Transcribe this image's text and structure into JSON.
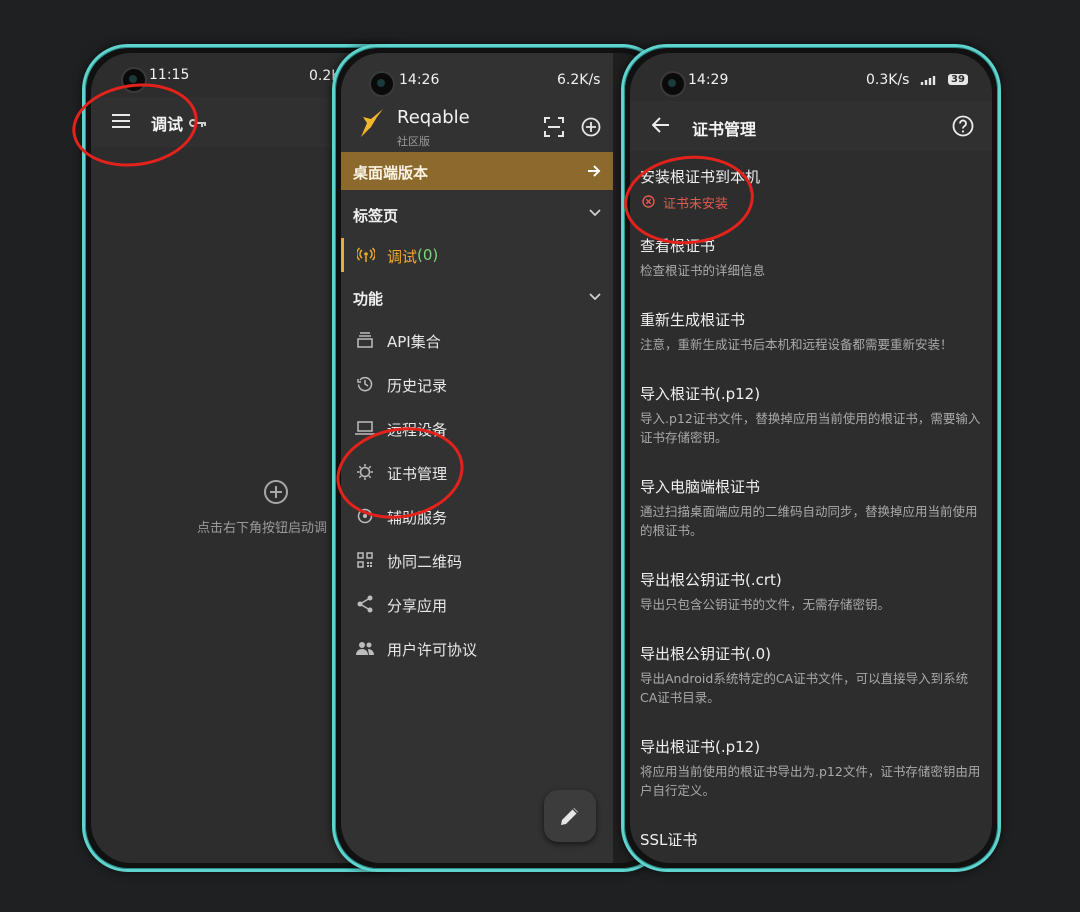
{
  "phone1": {
    "status_time": "11:15",
    "status_speed": "0.2K",
    "title": "调试",
    "empty_hint": "点击右下角按钮启动调",
    "icons": [
      "menu-icon",
      "key-icon",
      "add-circle-icon"
    ]
  },
  "phone2": {
    "status_time": "14:26",
    "status_speed": "6.2K/s",
    "app_name": "Reqable",
    "app_edition": "社区版",
    "banner": "桌面端版本",
    "section_tabs": "标签页",
    "debug_item": "调试",
    "debug_count": "(0)",
    "section_features": "功能",
    "menu": [
      {
        "label": "API集合",
        "icon": "collection-icon"
      },
      {
        "label": "历史记录",
        "icon": "history-icon"
      },
      {
        "label": "远程设备",
        "icon": "laptop-icon"
      },
      {
        "label": "证书管理",
        "icon": "gear-icon"
      },
      {
        "label": "辅助服务",
        "icon": "service-icon"
      },
      {
        "label": "协同二维码",
        "icon": "qrcode-icon"
      },
      {
        "label": "分享应用",
        "icon": "share-icon"
      },
      {
        "label": "用户许可协议",
        "icon": "people-icon"
      }
    ],
    "colors": {
      "banner": "#8c6a2e",
      "accent": "#f0a830"
    }
  },
  "phone3": {
    "status_time": "14:29",
    "status_speed": "0.3K/s",
    "battery": "39",
    "title": "证书管理",
    "install": {
      "title": "安装根证书到本机",
      "status": "证书未安装",
      "status_color": "#e05a4f"
    },
    "sections": [
      {
        "title": "查看根证书",
        "desc": "检查根证书的详细信息"
      },
      {
        "title": "重新生成根证书",
        "desc": "注意，重新生成证书后本机和远程设备都需要重新安装！"
      },
      {
        "title": "导入根证书(.p12)",
        "desc": "导入.p12证书文件，替换掉应用当前使用的根证书，需要输入证书存储密钥。"
      },
      {
        "title": "导入电脑端根证书",
        "desc": "通过扫描桌面端应用的二维码自动同步，替换掉应用当前使用的根证书。"
      },
      {
        "title": "导出根公钥证书(.crt)",
        "desc": "导出只包含公钥证书的文件，无需存储密钥。"
      },
      {
        "title": "导出根公钥证书(.0)",
        "desc": "导出Android系统特定的CA证书文件，可以直接导入到系统CA证书目录。"
      },
      {
        "title": "导出根证书(.p12)",
        "desc": "将应用当前使用的根证书导出为.p12文件，证书存储密钥由用户自行定义。"
      },
      {
        "title": "SSL证书",
        "desc": ""
      }
    ]
  }
}
